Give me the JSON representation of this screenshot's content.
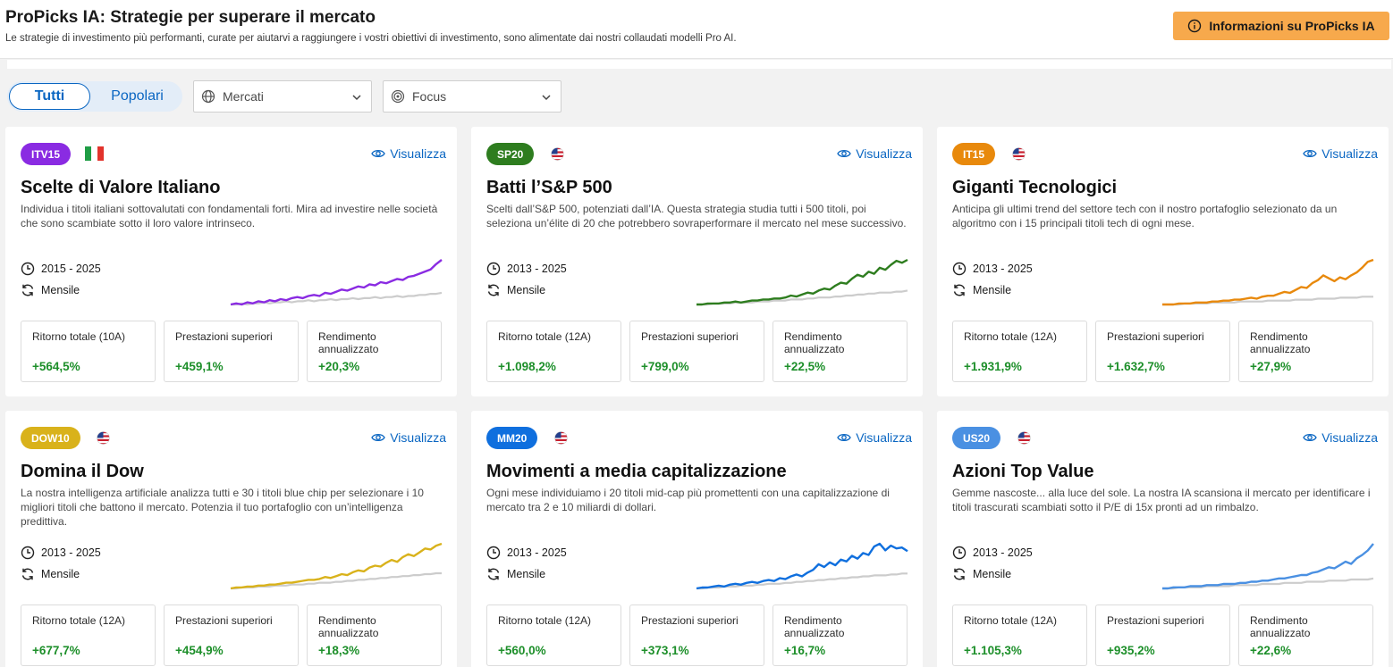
{
  "header": {
    "title": "ProPicks IA: Strategie per superare il mercato",
    "subtitle": "Le strategie di investimento più performanti, curate per aiutarvi a raggiungere i vostri obiettivi di investimento, sono alimentate dai nostri collaudati modelli Pro AI.",
    "info_button": "Informazioni su ProPicks IA"
  },
  "filters": {
    "tab_all": "Tutti",
    "tab_popular": "Popolari",
    "markets": "Mercati",
    "focus": "Focus"
  },
  "view_label": "Visualizza",
  "colors": {
    "accent_blue": "#0a66c2",
    "positive_green": "#1d8f2a",
    "benchmark_gray": "#cccccc",
    "info_orange": "#f7a94c"
  },
  "cards": [
    {
      "badge": "ITV15",
      "badge_color": "#8a2be2",
      "flag": "italy-flag-icon",
      "title": "Scelte di Valore Italiano",
      "description": "Individua i titoli italiani sottovalutati con fondamentali forti. Mira ad investire nelle società che sono scambiate sotto il loro valore intrinseco.",
      "period": "2015 - 2025",
      "frequency": "Mensile",
      "stats": [
        {
          "label": "Ritorno totale (10A)",
          "value": "+564,5%"
        },
        {
          "label": "Prestazioni superiori",
          "value": "+459,1%"
        },
        {
          "label": "Rendimento annualizzato",
          "value": "+20,3%"
        }
      ],
      "line_color": "#8a2be2",
      "strategy_curve": [
        0,
        1,
        0,
        2,
        1,
        3,
        2,
        4,
        3,
        5,
        4,
        6,
        7,
        6,
        8,
        9,
        8,
        11,
        10,
        12,
        14,
        13,
        15,
        17,
        16,
        19,
        18,
        21,
        20,
        22,
        24,
        23,
        26,
        27,
        29,
        31,
        33,
        38,
        42
      ],
      "benchmark_curve": [
        0,
        0,
        1,
        0,
        1,
        1,
        2,
        1,
        2,
        2,
        3,
        2,
        3,
        3,
        4,
        3,
        4,
        4,
        5,
        4,
        5,
        5,
        6,
        5,
        6,
        6,
        7,
        6,
        7,
        7,
        8,
        7,
        8,
        8,
        9,
        9,
        10,
        10,
        11
      ]
    },
    {
      "badge": "SP20",
      "badge_color": "#2e7d1f",
      "flag": "us-flag-icon",
      "title": "Batti l’S&P 500",
      "description": "Scelti dall’S&P 500, potenziati dall’IA. Questa strategia studia tutti i 500 titoli, poi seleziona un’élite di 20 che potrebbero sovraperformare il mercato nel mese successivo.",
      "period": "2013 - 2025",
      "frequency": "Mensile",
      "stats": [
        {
          "label": "Ritorno totale (12A)",
          "value": "+1.098,2%"
        },
        {
          "label": "Prestazioni superiori",
          "value": "+799,0%"
        },
        {
          "label": "Rendimento annualizzato",
          "value": "+22,5%"
        }
      ],
      "line_color": "#2e7d1f",
      "strategy_curve": [
        0,
        0,
        1,
        1,
        1,
        2,
        2,
        3,
        2,
        3,
        4,
        4,
        5,
        5,
        6,
        6,
        7,
        9,
        8,
        10,
        12,
        11,
        14,
        16,
        15,
        19,
        22,
        21,
        26,
        30,
        28,
        33,
        31,
        37,
        35,
        40,
        44,
        42,
        45
      ],
      "benchmark_curve": [
        0,
        0,
        0,
        1,
        1,
        1,
        1,
        2,
        2,
        2,
        2,
        3,
        3,
        3,
        4,
        4,
        4,
        5,
        5,
        5,
        6,
        6,
        7,
        7,
        7,
        8,
        8,
        9,
        9,
        10,
        10,
        11,
        11,
        12,
        12,
        12,
        13,
        13,
        14
      ]
    },
    {
      "badge": "IT15",
      "badge_color": "#e8890c",
      "flag": "us-flag-icon",
      "title": "Giganti Tecnologici",
      "description": "Anticipa gli ultimi trend del settore tech con il nostro portafoglio selezionato da un algoritmo con i 15 principali titoli tech di ogni mese.",
      "period": "2013 - 2025",
      "frequency": "Mensile",
      "stats": [
        {
          "label": "Ritorno totale (12A)",
          "value": "+1.931,9%"
        },
        {
          "label": "Prestazioni superiori",
          "value": "+1.632,7%"
        },
        {
          "label": "Rendimento annualizzato",
          "value": "+27,9%"
        }
      ],
      "line_color": "#e8890c",
      "strategy_curve": [
        0,
        0,
        0,
        1,
        1,
        1,
        2,
        2,
        2,
        3,
        3,
        4,
        4,
        5,
        5,
        6,
        7,
        6,
        8,
        9,
        9,
        11,
        13,
        12,
        15,
        18,
        17,
        22,
        25,
        30,
        27,
        24,
        28,
        26,
        30,
        33,
        38,
        44,
        46
      ],
      "benchmark_curve": [
        0,
        0,
        0,
        0,
        1,
        1,
        1,
        1,
        1,
        2,
        2,
        2,
        2,
        2,
        3,
        3,
        3,
        3,
        3,
        4,
        4,
        4,
        4,
        4,
        5,
        5,
        5,
        5,
        6,
        6,
        6,
        6,
        7,
        7,
        7,
        7,
        8,
        8,
        8
      ]
    },
    {
      "badge": "DOW10",
      "badge_color": "#d9b21b",
      "flag": "us-flag-icon",
      "title": "Domina il Dow",
      "description": "La nostra intelligenza artificiale analizza tutti e 30 i titoli blue chip per selezionare i 10 migliori titoli che battono il mercato. Potenzia il tuo portafoglio con un’intelligenza predittiva.",
      "period": "2013 - 2025",
      "frequency": "Mensile",
      "stats": [
        {
          "label": "Ritorno totale (12A)",
          "value": "+677,7%"
        },
        {
          "label": "Prestazioni superiori",
          "value": "+454,9%"
        },
        {
          "label": "Rendimento annualizzato",
          "value": "+18,3%"
        }
      ],
      "line_color": "#d9b21b",
      "strategy_curve": [
        0,
        1,
        1,
        2,
        2,
        3,
        3,
        4,
        4,
        5,
        6,
        6,
        7,
        8,
        9,
        9,
        10,
        12,
        11,
        13,
        15,
        14,
        17,
        19,
        18,
        22,
        24,
        23,
        27,
        30,
        28,
        33,
        36,
        34,
        38,
        42,
        41,
        45,
        47
      ],
      "benchmark_curve": [
        0,
        0,
        1,
        1,
        1,
        2,
        2,
        2,
        3,
        3,
        3,
        4,
        4,
        4,
        5,
        5,
        6,
        6,
        6,
        7,
        7,
        8,
        8,
        9,
        9,
        10,
        10,
        11,
        11,
        12,
        12,
        13,
        13,
        14,
        14,
        15,
        15,
        16,
        16
      ]
    },
    {
      "badge": "MM20",
      "badge_color": "#0f6fde",
      "flag": "us-flag-icon",
      "title": "Movimenti a media capitalizzazione",
      "description": "Ogni mese individuiamo i 20 titoli mid-cap più promettenti con una capitalizzazione di mercato tra 2 e 10 miliardi di dollari.",
      "period": "2013 - 2025",
      "frequency": "Mensile",
      "stats": [
        {
          "label": "Ritorno totale (12A)",
          "value": "+560,0%"
        },
        {
          "label": "Prestazioni superiori",
          "value": "+373,1%"
        },
        {
          "label": "Rendimento annualizzato",
          "value": "+16,7%"
        }
      ],
      "line_color": "#0f6fde",
      "strategy_curve": [
        0,
        1,
        1,
        2,
        3,
        2,
        4,
        5,
        4,
        6,
        7,
        6,
        8,
        9,
        8,
        11,
        10,
        13,
        15,
        13,
        17,
        20,
        26,
        23,
        28,
        25,
        31,
        29,
        35,
        32,
        38,
        36,
        45,
        48,
        41,
        46,
        43,
        44,
        40
      ],
      "benchmark_curve": [
        0,
        0,
        1,
        1,
        1,
        2,
        2,
        2,
        3,
        3,
        3,
        4,
        4,
        5,
        5,
        5,
        6,
        6,
        7,
        7,
        8,
        8,
        9,
        9,
        10,
        10,
        11,
        11,
        12,
        12,
        13,
        13,
        14,
        14,
        14,
        15,
        15,
        16,
        16
      ]
    },
    {
      "badge": "US20",
      "badge_color": "#4a90e2",
      "flag": "us-flag-icon",
      "title": "Azioni Top Value",
      "description": "Gemme nascoste... alla luce del sole. La nostra IA scansiona il mercato per identificare i titoli trascurati scambiati sotto il P/E di 15x pronti ad un rimbalzo.",
      "period": "2013 - 2025",
      "frequency": "Mensile",
      "stats": [
        {
          "label": "Ritorno totale (12A)",
          "value": "+1.105,3%"
        },
        {
          "label": "Prestazioni superiori",
          "value": "+935,2%"
        },
        {
          "label": "Rendimento annualizzato",
          "value": "+22,6%"
        }
      ],
      "line_color": "#4a90e2",
      "strategy_curve": [
        0,
        0,
        1,
        1,
        1,
        2,
        2,
        2,
        3,
        3,
        3,
        4,
        4,
        4,
        5,
        5,
        6,
        6,
        7,
        7,
        8,
        9,
        9,
        10,
        11,
        12,
        12,
        14,
        15,
        17,
        19,
        18,
        21,
        24,
        22,
        27,
        30,
        34,
        40
      ],
      "benchmark_curve": [
        0,
        0,
        0,
        1,
        1,
        1,
        1,
        1,
        2,
        2,
        2,
        2,
        2,
        3,
        3,
        3,
        3,
        3,
        4,
        4,
        4,
        4,
        5,
        5,
        5,
        5,
        6,
        6,
        6,
        6,
        7,
        7,
        7,
        7,
        8,
        8,
        8,
        8,
        9
      ]
    }
  ]
}
